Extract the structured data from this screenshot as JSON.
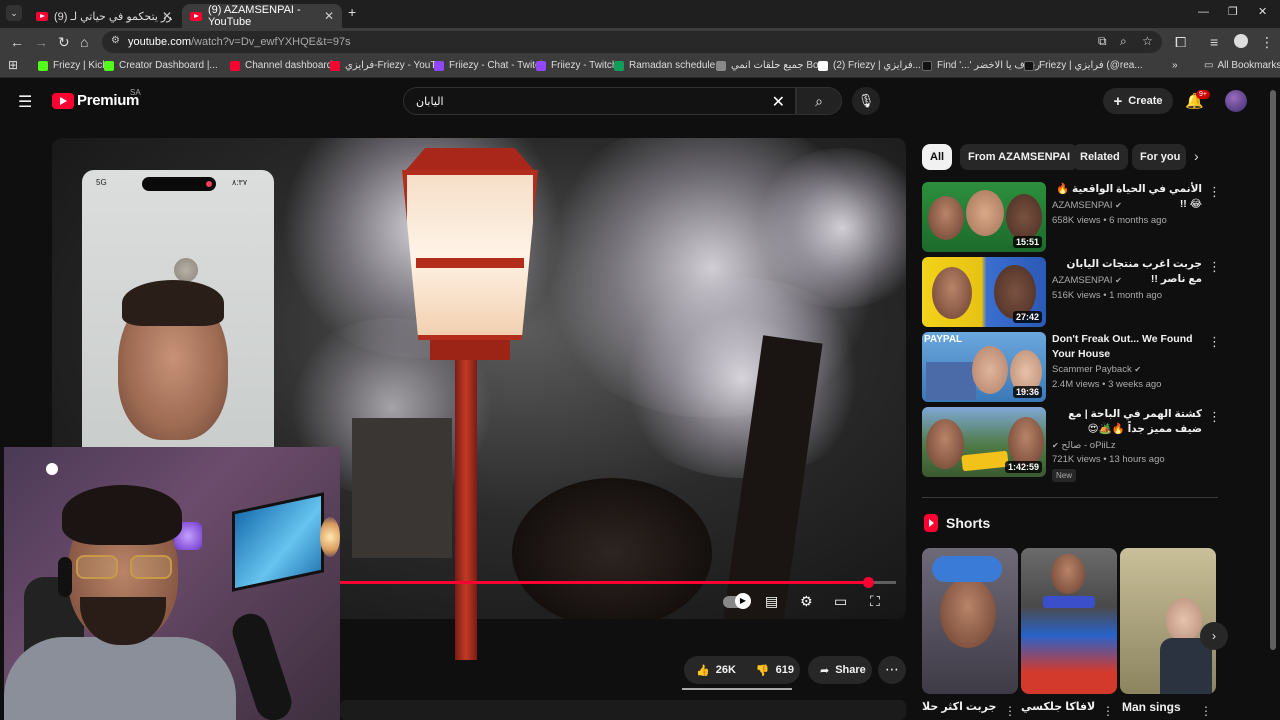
{
  "browser": {
    "tabs": [
      {
        "title": "(9) اليوتيوبرز يتحكمو في حياتي لـ..."
      },
      {
        "title": "(9) AZAMSENPAI - YouTube"
      }
    ],
    "new_tab": "+",
    "url_host": "youtube.com",
    "url_path": "/watch?v=Dv_ewfYXHQE&t=97s",
    "bookmarks": [
      {
        "label": "Friezy | Kick",
        "color": "#53fc18"
      },
      {
        "label": "Creator Dashboard |...",
        "color": "#53fc18"
      },
      {
        "label": "Channel dashboard...",
        "color": "#ff0033"
      },
      {
        "label": "فرايزي-Friezy - YouT...",
        "color": "#ff0033"
      },
      {
        "label": "Friiezy - Chat - Twitch",
        "color": "#9146ff"
      },
      {
        "label": "Friiezy - Twitch",
        "color": "#9146ff"
      },
      {
        "label": "Ramadan schedule...",
        "color": "#0f9d58"
      },
      {
        "label": "جميع حلقات انمي Bo...",
        "color": "#888888"
      },
      {
        "label": "(2) Friezy | فرايزي...",
        "color": "#ffffff"
      },
      {
        "label": "Find '...' رفرف يا الاخضر",
        "color": "#111111"
      },
      {
        "label": "Friezy | فرايزي (@rea...",
        "color": "#111111"
      }
    ],
    "all_bookmarks": "All Bookmarks"
  },
  "header": {
    "logo_text": "Premium",
    "logo_country": "SA",
    "search_value": "اليابان",
    "create_label": "Create",
    "notif_count": "9+"
  },
  "player": {
    "phone_time": "٨:٣٧",
    "phone_signal": "5G",
    "progress_fraction": 0.95
  },
  "actions": {
    "likes": "26K",
    "dislikes": "619",
    "share": "Share"
  },
  "chips": [
    "All",
    "From AZAMSENPAI",
    "Related",
    "For you"
  ],
  "recommendations": [
    {
      "title": "الأنمي في الحياة الواقعية 🔥😂 !!",
      "channel": "AZAMSENPAI",
      "meta": "658K views • 6 months ago",
      "duration": "15:51",
      "is_new": false
    },
    {
      "title": "جربت اغرب منتجات اليابان مع ناصر !!",
      "channel": "AZAMSENPAI",
      "meta": "516K views • 1 month ago",
      "duration": "27:42",
      "is_new": false
    },
    {
      "title": "Don't Freak Out... We Found Your House",
      "channel": "Scammer Payback",
      "meta": "2.4M views • 3 weeks ago",
      "duration": "19:36",
      "is_new": false
    },
    {
      "title": "كشتة الهمر في الباحة | مع ضيف مميز جداً 🔥🏕️😍",
      "channel": "صالح - oPiiLz",
      "meta": "721K views • 13 hours ago",
      "duration": "1:42:59",
      "is_new": true,
      "new_label": "New"
    }
  ],
  "shorts": {
    "heading": "Shorts",
    "items": [
      {
        "title": "جربت اكثر حلا"
      },
      {
        "title": "لافاكا جلكسي"
      },
      {
        "title": "Man sings"
      }
    ]
  },
  "colors": {
    "accent": "#ff0033",
    "background": "#0f0f0f",
    "chip_bg": "#272727"
  }
}
